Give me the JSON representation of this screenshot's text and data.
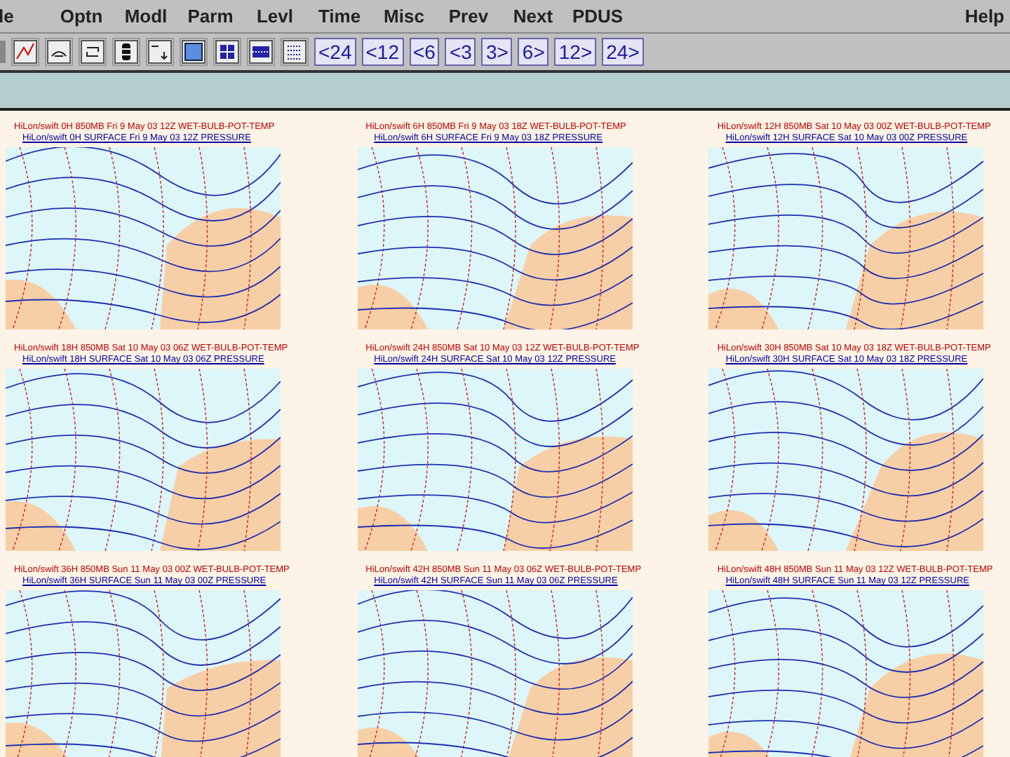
{
  "menu": [
    "le",
    "Optn",
    "Modl",
    "Parm",
    "Levl",
    "Time",
    "Misc",
    "Prev",
    "Next",
    "PDUS"
  ],
  "help": "Help",
  "time_steps": [
    "<24",
    "<12",
    "<6",
    "<3",
    "3>",
    "6>",
    "12>",
    "24>"
  ],
  "panels": [
    {
      "upper": "HiLon/swift 0H 850MB Fri 9 May 03 12Z WET-BULB-POT-TEMP",
      "lower": "HiLon/swift 0H SURFACE Fri 9 May 03 12Z PRESSURE"
    },
    {
      "upper": "HiLon/swift 6H 850MB Fri 9 May 03 18Z WET-BULB-POT-TEMP",
      "lower": "HiLon/swift 6H SURFACE Fri 9 May 03 18Z PRESSURE"
    },
    {
      "upper": "HiLon/swift 12H 850MB Sat 10 May 03 00Z WET-BULB-POT-TEMP",
      "lower": "HiLon/swift 12H SURFACE Sat 10 May 03 00Z PRESSURE"
    },
    {
      "upper": "HiLon/swift 18H 850MB Sat 10 May 03 06Z WET-BULB-POT-TEMP",
      "lower": "HiLon/swift 18H SURFACE Sat 10 May 03 06Z PRESSURE"
    },
    {
      "upper": "HiLon/swift 24H 850MB Sat 10 May 03 12Z WET-BULB-POT-TEMP",
      "lower": "HiLon/swift 24H SURFACE Sat 10 May 03 12Z PRESSURE"
    },
    {
      "upper": "HiLon/swift 30H 850MB Sat 10 May 03 18Z WET-BULB-POT-TEMP",
      "lower": "HiLon/swift 30H SURFACE Sat 10 May 03 18Z PRESSURE"
    },
    {
      "upper": "HiLon/swift 36H 850MB Sun 11 May 03 00Z WET-BULB-POT-TEMP",
      "lower": "HiLon/swift 36H SURFACE Sun 11 May 03 00Z PRESSURE"
    },
    {
      "upper": "HiLon/swift 42H 850MB Sun 11 May 03 06Z WET-BULB-POT-TEMP",
      "lower": "HiLon/swift 42H SURFACE Sun 11 May 03 06Z PRESSURE"
    },
    {
      "upper": "HiLon/swift 48H 850MB Sun 11 May 03 12Z WET-BULB-POT-TEMP",
      "lower": "HiLon/swift 48H SURFACE Sun 11 May 03 12Z PRESSURE"
    }
  ]
}
